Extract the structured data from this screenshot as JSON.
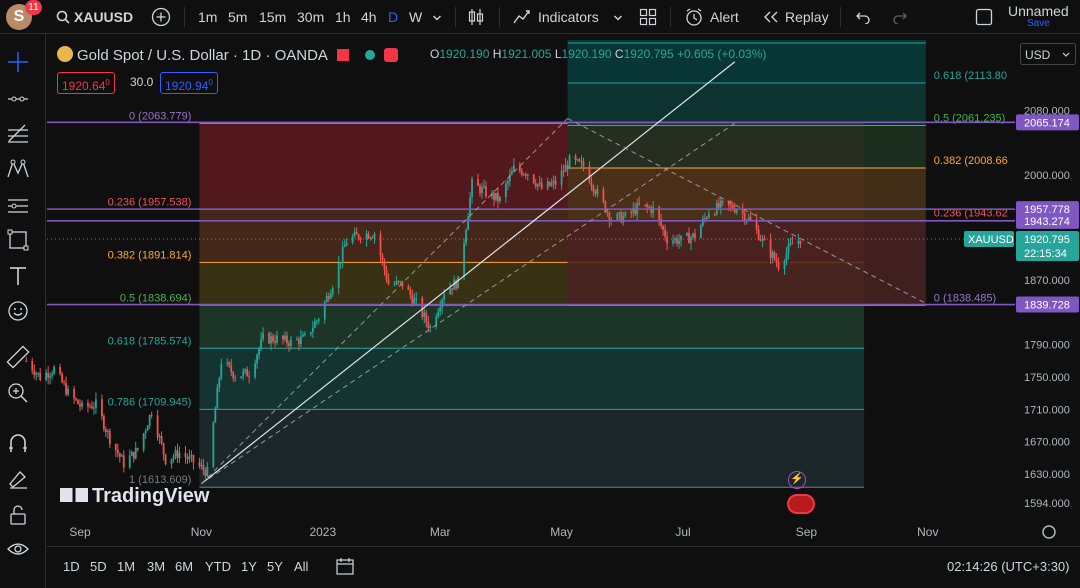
{
  "topbar": {
    "avatar_letter": "S",
    "notifications": "11",
    "symbol": "XAUUSD",
    "intervals": [
      "1m",
      "5m",
      "15m",
      "30m",
      "1h",
      "4h",
      "D",
      "W"
    ],
    "active_interval": "D",
    "indicators_label": "Indicators",
    "alert_label": "Alert",
    "replay_label": "Replay",
    "layout_name": "Unnamed",
    "save_label": "Save"
  },
  "legend": {
    "title": "Gold Spot / U.S. Dollar · 1D · OANDA",
    "open_label": "O",
    "open": "1920.190",
    "high_label": "H",
    "high": "1921.005",
    "low_label": "L",
    "low": "1920.190",
    "close_label": "C",
    "close": "1920.795",
    "change": "+0.605 (+0.03%)",
    "sell_price": "1920.64",
    "sell_sup": "0",
    "spread": "30.0",
    "buy_price": "1920.94",
    "buy_sup": "0"
  },
  "currency": "USD",
  "watermark": "TradingView",
  "bottombar": {
    "ranges": [
      "1D",
      "5D",
      "1M",
      "3M",
      "6M",
      "YTD",
      "1Y",
      "5Y",
      "All"
    ],
    "clock": "02:14:26 (UTC+3:30)"
  },
  "colors": {
    "up": "#26a69a",
    "down": "#ef5350",
    "accent": "#2962ff",
    "fib_line_main": "#9575cd"
  },
  "chart_data": {
    "type": "candlestick",
    "symbol": "XAUUSD",
    "last_price": "1920.795",
    "countdown": "22:15:34",
    "x_labels": [
      {
        "label": "Sep",
        "date": "2022-09-01"
      },
      {
        "label": "Nov",
        "date": "2022-11-01"
      },
      {
        "label": "2023",
        "date": "2023-01-01"
      },
      {
        "label": "Mar",
        "date": "2023-03-01"
      },
      {
        "label": "May",
        "date": "2023-05-01"
      },
      {
        "label": "Jul",
        "date": "2023-07-01"
      },
      {
        "label": "Sep",
        "date": "2023-09-01"
      },
      {
        "label": "Nov",
        "date": "2023-11-01"
      }
    ],
    "y_ticks": [
      "2080.000",
      "2000.000",
      "1870.000",
      "1790.000",
      "1750.000",
      "1710.000",
      "1670.000",
      "1630.000",
      "1594.000"
    ],
    "price_tags": [
      {
        "label": "2065.174",
        "value": 2065.174,
        "color": "#7e57c2"
      },
      {
        "label": "1957.778",
        "value": 1957.778,
        "color": "#7e57c2"
      },
      {
        "label": "1943.274",
        "value": 1943.274,
        "color": "#7e57c2"
      },
      {
        "label": "1839.728",
        "value": 1839.728,
        "color": "#7e57c2"
      }
    ],
    "fib_left": {
      "start": "2022-10-31",
      "end": "2023-09-30",
      "levels": [
        {
          "label": "0 (2063.779)",
          "value": 2063.779
        },
        {
          "label": "0.236 (1957.538)",
          "value": 1957.538
        },
        {
          "label": "0.382 (1891.814)",
          "value": 1891.814
        },
        {
          "label": "0.5 (1838.694)",
          "value": 1838.694
        },
        {
          "label": "0.618 (1785.574)",
          "value": 1785.574
        },
        {
          "label": "0.786 (1709.945)",
          "value": 1709.945
        },
        {
          "label": "1 (1613.609)",
          "value": 1613.609
        }
      ]
    },
    "fib_right": {
      "start": "2023-05-04",
      "end": "2023-10-31",
      "levels": [
        {
          "label": "0.618 (2113.80",
          "value": 2113.8
        },
        {
          "label": "0.5 (2061.235)",
          "value": 2061.235
        },
        {
          "label": "0.382 (2008.66",
          "value": 2008.66
        },
        {
          "label": "0.236 (1943.62",
          "value": 1943.62
        },
        {
          "label": "0 (1838.485)",
          "value": 1838.485
        }
      ]
    },
    "trend_lines": [
      {
        "from": [
          "2022-11-01",
          1618
        ],
        "to": [
          "2023-07-27",
          2140
        ],
        "style": "solid"
      },
      {
        "from": [
          "2022-11-01",
          1618
        ],
        "to": [
          "2023-07-27",
          2064
        ],
        "style": "dashed"
      },
      {
        "from": [
          "2022-11-01",
          1618
        ],
        "to": [
          "2023-05-04",
          2070
        ],
        "style": "dashed"
      },
      {
        "from": [
          "2023-05-04",
          2070
        ],
        "to": [
          "2023-11-01",
          1840
        ],
        "style": "dashed"
      }
    ],
    "closes": [
      [
        "2022-08-05",
        1770
      ],
      [
        "2022-08-12",
        1750
      ],
      [
        "2022-08-19",
        1760
      ],
      [
        "2022-08-26",
        1730
      ],
      [
        "2022-09-02",
        1712
      ],
      [
        "2022-09-09",
        1716
      ],
      [
        "2022-09-16",
        1674
      ],
      [
        "2022-09-23",
        1643
      ],
      [
        "2022-09-30",
        1660
      ],
      [
        "2022-10-07",
        1708
      ],
      [
        "2022-10-14",
        1648
      ],
      [
        "2022-10-21",
        1656
      ],
      [
        "2022-10-28",
        1645
      ],
      [
        "2022-11-04",
        1632
      ],
      [
        "2022-11-11",
        1770
      ],
      [
        "2022-11-18",
        1752
      ],
      [
        "2022-11-25",
        1755
      ],
      [
        "2022-12-02",
        1798
      ],
      [
        "2022-12-09",
        1797
      ],
      [
        "2022-12-16",
        1793
      ],
      [
        "2022-12-23",
        1798
      ],
      [
        "2022-12-30",
        1824
      ],
      [
        "2023-01-06",
        1866
      ],
      [
        "2023-01-13",
        1919
      ],
      [
        "2023-01-20",
        1926
      ],
      [
        "2023-01-27",
        1928
      ],
      [
        "2023-02-03",
        1865
      ],
      [
        "2023-02-10",
        1865
      ],
      [
        "2023-02-17",
        1841
      ],
      [
        "2023-02-24",
        1811
      ],
      [
        "2023-03-03",
        1856
      ],
      [
        "2023-03-10",
        1868
      ],
      [
        "2023-03-17",
        1989
      ],
      [
        "2023-03-24",
        1978
      ],
      [
        "2023-03-31",
        1969
      ],
      [
        "2023-04-07",
        2008
      ],
      [
        "2023-04-14",
        2003
      ],
      [
        "2023-04-21",
        1983
      ],
      [
        "2023-04-28",
        1990
      ],
      [
        "2023-05-05",
        2017
      ],
      [
        "2023-05-12",
        2011
      ],
      [
        "2023-05-19",
        1977
      ],
      [
        "2023-05-26",
        1946
      ],
      [
        "2023-06-02",
        1948
      ],
      [
        "2023-06-09",
        1961
      ],
      [
        "2023-06-16",
        1958
      ],
      [
        "2023-06-23",
        1921
      ],
      [
        "2023-06-30",
        1919
      ],
      [
        "2023-07-07",
        1925
      ],
      [
        "2023-07-14",
        1955
      ],
      [
        "2023-07-21",
        1962
      ],
      [
        "2023-07-28",
        1959
      ],
      [
        "2023-08-04",
        1943
      ],
      [
        "2023-08-11",
        1914
      ],
      [
        "2023-08-18",
        1889
      ],
      [
        "2023-08-25",
        1915
      ],
      [
        "2023-08-29",
        1920.8
      ]
    ]
  }
}
